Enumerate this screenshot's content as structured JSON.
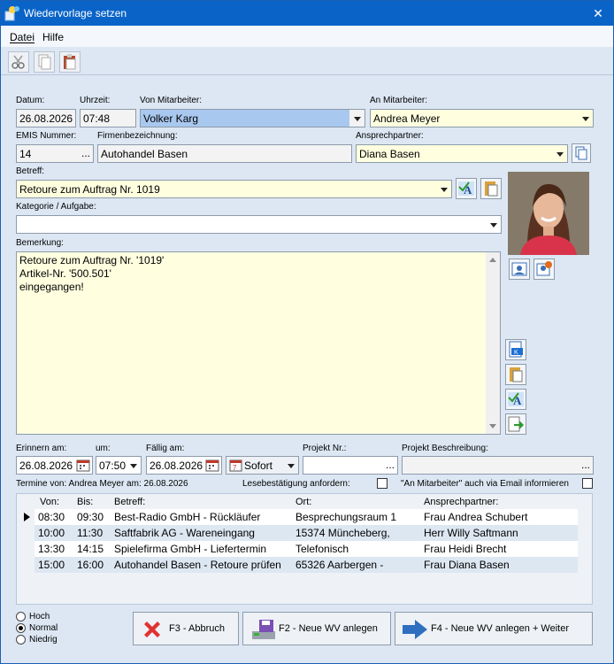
{
  "window": {
    "title": "Wiedervorlage setzen",
    "close_glyph": "✕"
  },
  "menu": [
    "Datei",
    "Hilfe"
  ],
  "labels": {
    "datum": "Datum:",
    "uhrzeit": "Uhrzeit:",
    "von": "Von Mitarbeiter:",
    "an": "An Mitarbeiter:",
    "emis": "EMIS Nummer:",
    "firma": "Firmenbezeichnung:",
    "ansprech": "Ansprechpartner:",
    "betreff": "Betreff:",
    "kategorie": "Kategorie / Aufgabe:",
    "bemerkung": "Bemerkung:",
    "erinnern": "Erinnern am:",
    "um": "um:",
    "faellig": "Fällig am:",
    "projekt_nr": "Projekt Nr.:",
    "projekt_beschr": "Projekt Beschreibung:",
    "termine": "Termine von: Andrea Meyer am: 26.08.2026",
    "lese": "Lesebestätigung anfordern:",
    "email": "\"An Mitarbeiter\" auch via Email informieren"
  },
  "values": {
    "datum": "26.08.2026",
    "uhrzeit": "07:48",
    "von": "Volker Karg",
    "an": "Andrea Meyer",
    "emis": "14",
    "emis_btn": "...",
    "firma": "Autohandel Basen",
    "ansprech": "Diana Basen",
    "betreff": "Retoure zum Auftrag Nr. 1019",
    "kategorie": "",
    "bemerkung": [
      "Retoure zum Auftrag Nr. '1019'",
      "Artikel-Nr. '500.501'",
      "eingegangen!"
    ],
    "erinnern": "26.08.2026",
    "um": "07:50",
    "faellig": "26.08.2026",
    "sofort": "Sofort",
    "projekt_nr": "",
    "projekt_nr_btn": "...",
    "projekt_beschr": "",
    "projekt_beschr_btn": "..."
  },
  "grid": {
    "headers": [
      "Von:",
      "Bis:",
      "Betreff:",
      "Ort:",
      "Ansprechpartner:"
    ],
    "rows": [
      [
        "08:30",
        "09:30",
        "Best-Radio GmbH - Rückläufer",
        "Besprechungsraum 1",
        "Frau Andrea Schubert"
      ],
      [
        "10:00",
        "11:30",
        "Saftfabrik AG - Wareneingang",
        "15374 Müncheberg,",
        "Herr Willy Saftmann"
      ],
      [
        "13:30",
        "14:15",
        "Spielefirma GmbH - Liefertermin",
        "Telefonisch",
        "Frau Heidi Brecht"
      ],
      [
        "15:00",
        "16:00",
        "Autohandel Basen - Retoure prüfen",
        "65326 Aarbergen -",
        "Frau Diana Basen"
      ]
    ]
  },
  "priority": {
    "options": [
      "Hoch",
      "Normal",
      "Niedrig"
    ],
    "selected": "Normal"
  },
  "buttons": {
    "abbruch": "F3 - Abbruch",
    "anlegen": "F2 - Neue WV anlegen",
    "weiter": "F4 - Neue WV anlegen + Weiter"
  },
  "colors": {
    "titlebar": "#0a64c8",
    "window_bg": "#dce7f3",
    "yellow_field": "#ffffe0",
    "selected_field": "#a9c8ef"
  }
}
